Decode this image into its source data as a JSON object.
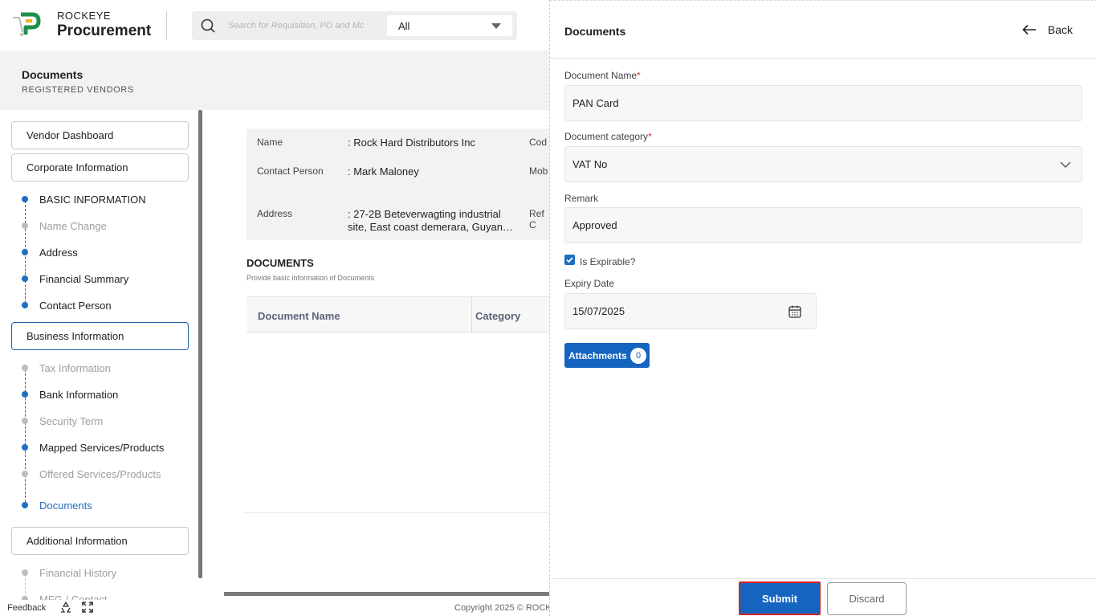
{
  "header": {
    "brand_top": "ROCKEYE",
    "brand_bottom": "Procurement",
    "search_placeholder": "Search for Requisition, PO and Mc",
    "search_scope": "All"
  },
  "subheader": {
    "title": "Documents",
    "subtitle": "REGISTERED VENDORS"
  },
  "sidebar": {
    "vendor_dashboard": "Vendor Dashboard",
    "corporate_information": "Corporate Information",
    "corporate_items": [
      {
        "label": "BASIC INFORMATION",
        "state": "done"
      },
      {
        "label": "Name Change",
        "state": "inactive"
      },
      {
        "label": "Address",
        "state": "done"
      },
      {
        "label": "Financial Summary",
        "state": "done"
      },
      {
        "label": "Contact Person",
        "state": "done"
      }
    ],
    "business_information": "Business Information",
    "business_items": [
      {
        "label": "Tax Information",
        "state": "inactive"
      },
      {
        "label": "Bank Information",
        "state": "done"
      },
      {
        "label": "Security Term",
        "state": "inactive"
      },
      {
        "label": "Mapped Services/Products",
        "state": "done"
      },
      {
        "label": "Offered Services/Products",
        "state": "inactive"
      },
      {
        "label": "Documents",
        "state": "current"
      }
    ],
    "additional_information": "Additional Information",
    "additional_items": [
      {
        "label": "Financial History",
        "state": "inactive"
      },
      {
        "label": "MFG / Contact",
        "state": "inactive"
      }
    ]
  },
  "vendor": {
    "name_label": "Name",
    "name_value": ": Rock Hard Distributors Inc",
    "contact_label": "Contact Person",
    "contact_value": ": Mark Maloney",
    "address_label": "Address",
    "address_line1": ": 27-2B Beteverwagting industrial",
    "address_line2": "site, East coast demerara, Guyan…",
    "code_label": "Cod",
    "mobile_label": "Mob",
    "ref_label": "Ref C"
  },
  "documents_section": {
    "title": "DOCUMENTS",
    "subtitle": "Provide basic information of Documents",
    "col_name": "Document Name",
    "col_category": "Category"
  },
  "footer": {
    "feedback": "Feedback",
    "copyright": "Copyright 2025 © ROCK"
  },
  "drawer": {
    "title": "Documents",
    "back_label": "Back",
    "doc_name_label": "Document Name",
    "doc_name_value": "PAN Card",
    "doc_category_label": "Document category",
    "doc_category_value": "VAT No",
    "remark_label": "Remark",
    "remark_value": "Approved",
    "required_mark": "*",
    "is_expirable_label": "Is Expirable?",
    "is_expirable_checked": true,
    "expiry_label": "Expiry Date",
    "expiry_value": "15/07/2025",
    "attachments_label": "Attachments",
    "attachments_count": "0",
    "submit_label": "Submit",
    "discard_label": "Discard"
  },
  "colors": {
    "primary": "#1565c0",
    "required": "#d32f2f",
    "highlight_border": "#e02020"
  }
}
